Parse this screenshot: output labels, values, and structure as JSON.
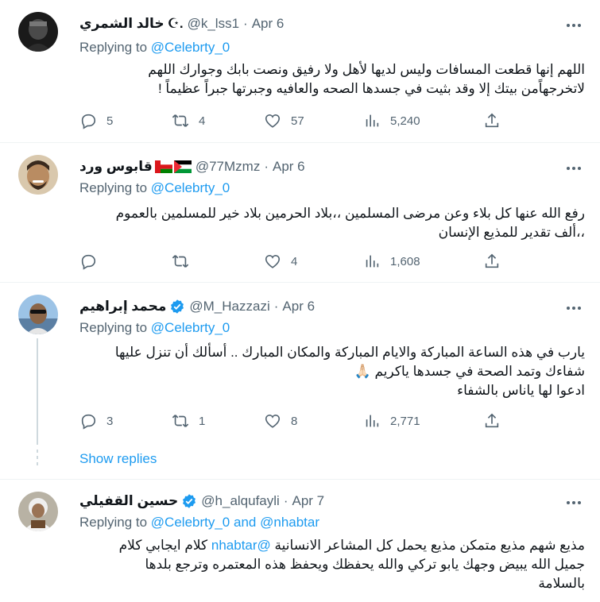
{
  "tweets": [
    {
      "name": "خالد الشمري",
      "name_suffix": "☪︎.",
      "handle": "@k_lss1",
      "date": "Apr 6",
      "verified": false,
      "replying_prefix": "Replying to",
      "replying_to": "@Celebrty_0",
      "replying_and": "",
      "replying_to_2": "",
      "text_lines": [
        "اللهم إنها قطعت المسافات وليس لديها لأهل ولا رفيق ونصت بابك وجوارك اللهم",
        "لاتخرجهاًمن بيتك إلا وقد بثيت في جسدها الصحه والعافيه وجبرتها جبراً عظيماً !"
      ],
      "replies": "5",
      "retweets": "4",
      "likes": "57",
      "views": "5,240"
    },
    {
      "name": "قابوس ورد",
      "flags": [
        "oman-flag-icon",
        "palestine-flag-icon"
      ],
      "handle": "@77Mzmz",
      "date": "Apr 6",
      "verified": false,
      "replying_prefix": "Replying to",
      "replying_to": "@Celebrty_0",
      "text_lines": [
        "رفع الله عنها كل بلاء وعن مرضى المسلمين ،،بلاد الحرمين بلاد خير للمسلمين بالعموم",
        "،،ألف تقدير للمذيع الإنسان"
      ],
      "replies": "",
      "retweets": "",
      "likes": "4",
      "views": "1,608"
    },
    {
      "name": "محمد إبراهيم",
      "handle": "@M_Hazzazi",
      "date": "Apr 6",
      "verified": true,
      "replying_prefix": "Replying to",
      "replying_to": "@Celebrty_0",
      "text_lines": [
        "يارب في هذه الساعة المباركة والايام المباركة والمكان المبارك .. أسألك أن تنزل عليها",
        "شفاءك وتمد الصحة في جسدها ياكريم 🙏🏻",
        "ادعوا لها ياناس بالشفاء"
      ],
      "replies": "3",
      "retweets": "1",
      "likes": "8",
      "views": "2,771",
      "show_replies": "Show replies"
    },
    {
      "name": "حسين القفيلي",
      "handle": "@h_alqufayli",
      "date": "Apr 7",
      "verified": true,
      "replying_prefix": "Replying to",
      "replying_to": "@Celebrty_0",
      "replying_and": "and",
      "replying_to_2": "@nhabtar",
      "text_line1_pre": "مذيع شهم مذيع متمكن مذيع يحمل كل المشاعر الانسانية",
      "text_line1_mention": "@nhabtar",
      "text_line1_post": "كلام ايجابي كلام",
      "text_lines": [
        "جميل الله يبيض وجهك يابو تركي والله يحفظك ويحفظ هذه المعتمره وترجع بلدها",
        "بالسلامة"
      ]
    }
  ],
  "colors": {
    "link": "#1d9bf0",
    "secondary": "#536471",
    "text": "#0f1419",
    "verified": "#1d9bf0",
    "divider": "#eff3f4"
  }
}
